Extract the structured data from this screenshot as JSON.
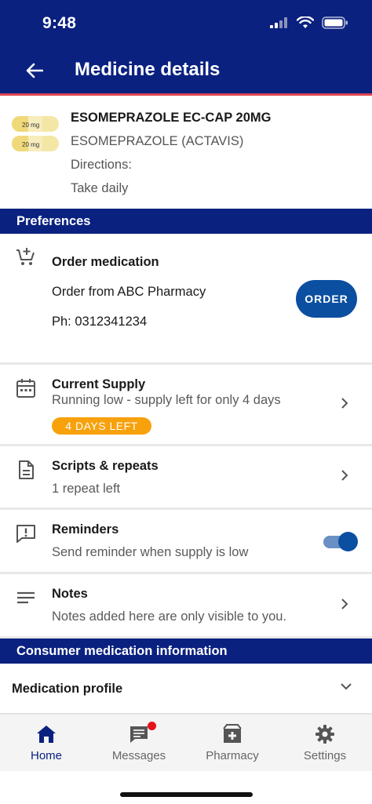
{
  "status_bar": {
    "time": "9:48"
  },
  "header": {
    "title": "Medicine details"
  },
  "medicine": {
    "name": "ESOMEPRAZOLE EC-CAP 20MG",
    "generic": "ESOMEPRAZOLE (ACTAVIS)",
    "directions_label": "Directions:",
    "directions": "Take daily",
    "pill_label_1": "20 mg",
    "pill_label_2": "20 mg"
  },
  "sections": {
    "preferences": "Preferences",
    "consumer_info": "Consumer medication information"
  },
  "order": {
    "title": "Order medication",
    "pharmacy": "Order from ABC Pharmacy",
    "phone": "Ph: 0312341234",
    "button_label": "ORDER"
  },
  "supply": {
    "title": "Current Supply",
    "subtitle": "Running low - supply left for only 4 days",
    "badge": "4 DAYS LEFT"
  },
  "scripts": {
    "title": "Scripts & repeats",
    "subtitle": "1 repeat left"
  },
  "reminders": {
    "title": "Reminders",
    "subtitle": "Send reminder when supply is low",
    "enabled": true
  },
  "notes": {
    "title": "Notes",
    "subtitle": "Notes added here are only visible to you."
  },
  "profile": {
    "title": "Medication profile"
  },
  "nav": {
    "items": [
      {
        "label": "Home",
        "icon": "home-icon",
        "active": true
      },
      {
        "label": "Messages",
        "icon": "messages-icon",
        "active": false
      },
      {
        "label": "Pharmacy",
        "icon": "pharmacy-icon",
        "active": false
      },
      {
        "label": "Settings",
        "icon": "settings-icon",
        "active": false
      }
    ]
  },
  "colors": {
    "brand_navy": "#0a2180",
    "accent_red": "#e0454f",
    "button_blue": "#0b4fa0",
    "badge_orange": "#f7a10c"
  }
}
